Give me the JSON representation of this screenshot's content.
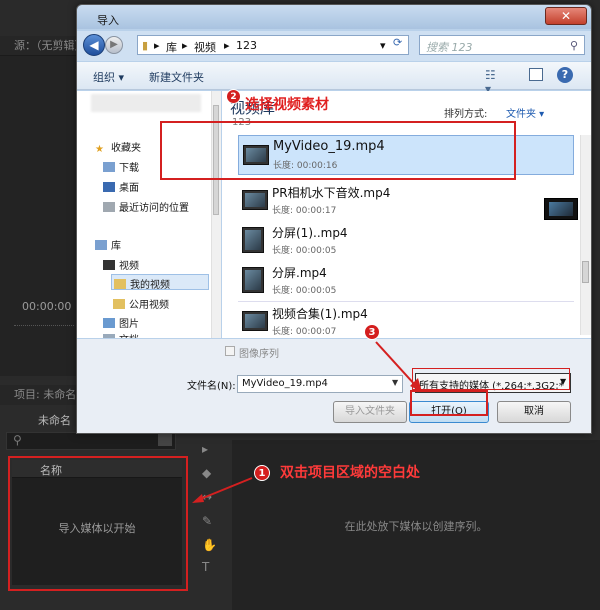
{
  "premiere": {
    "source_tab": "源：（无剪辑）",
    "timecode": "00:00:00",
    "project_tab": "项目: 未命名",
    "project_name": "未命名",
    "project_column_header": "名称",
    "import_hint": "导入媒体以开始",
    "timeline_hint": "在此处放下媒体以创建序列。"
  },
  "dialog": {
    "title": "导入",
    "close_label": "✕",
    "breadcrumbs": [
      "库",
      "视频",
      "123"
    ],
    "search_placeholder": "搜索 123",
    "toolbar": {
      "organize": "组织 ▾",
      "new_folder": "新建文件夹"
    },
    "nav": {
      "favorites": "收藏夹",
      "downloads": "下载",
      "desktop": "桌面",
      "recent": "最近访问的位置",
      "libraries": "库",
      "videos": "视频",
      "my_videos": "我的视频",
      "public_videos": "公用视频",
      "pictures": "图片",
      "documents": "文档"
    },
    "content": {
      "library_title": "视频库",
      "library_sub": "123",
      "sort_label": "排列方式:",
      "sort_value": "文件夹 ▾"
    },
    "files": [
      {
        "name": "MyVideo_19.mp4",
        "duration": "长度: 00:00:16",
        "selected": true
      },
      {
        "name": "PR相机水下音效.mp4",
        "duration": "长度: 00:00:17",
        "selected": false
      },
      {
        "name": "分屏(1)..mp4",
        "duration": "长度: 00:00:05",
        "selected": false
      },
      {
        "name": "分屏.mp4",
        "duration": "长度: 00:00:05",
        "selected": false
      },
      {
        "name": "视频合集(1).mp4",
        "duration": "长度: 00:00:07",
        "selected": false
      }
    ],
    "image_sequence_label": "图像序列",
    "filename_label": "文件名(N):",
    "filename_value": "MyVideo_19.mp4",
    "filter_value": "所有支持的媒体 (*.264;*.3G2;*",
    "buttons": {
      "import_folder": "导入文件夹",
      "open": "打开(O)",
      "cancel": "取消"
    }
  },
  "annotations": {
    "step1_num": "1",
    "step1_text": "双击项目区域的空白处",
    "step2_num": "2",
    "step2_text": "选择视频素材",
    "step3_num": "3"
  },
  "colors": {
    "annotation_red": "#d42020",
    "selection_blue": "#cce4fb"
  }
}
